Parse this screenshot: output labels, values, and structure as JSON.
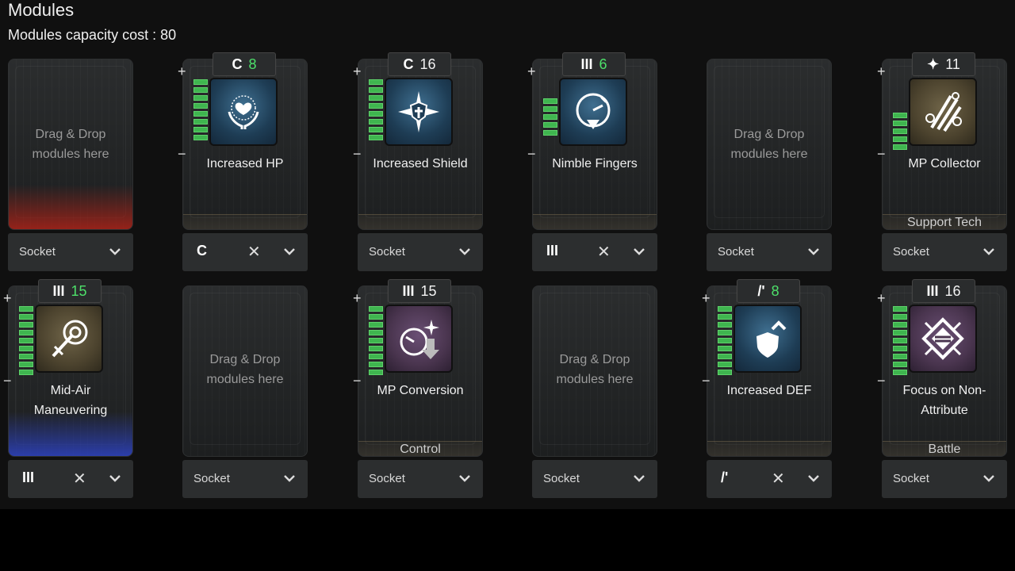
{
  "header": {
    "title": "Modules",
    "capacity": "Modules capacity cost : 80"
  },
  "labels": {
    "drag1": "Drag & Drop",
    "drag2": "modules here",
    "plus": "+",
    "minus": "−",
    "close": "✕",
    "socket": "Socket"
  },
  "slots": {
    "s1": {
      "state": "empty",
      "glow": "red"
    },
    "s2": {
      "cost": "8",
      "cost_green": true,
      "polarity": "crescent-icon",
      "glyph": "C",
      "name": "Increased HP",
      "filled_bars": 8
    },
    "s3": {
      "cost": "16",
      "cost_green": false,
      "polarity": "crescent-icon",
      "glyph": "C",
      "name": "Increased Shield",
      "filled_bars": 8
    },
    "s4": {
      "cost": "6",
      "cost_green": true,
      "polarity": "triple-bar-icon",
      "glyph": "III",
      "name": "Nimble Fingers",
      "filled_bars": 5
    },
    "s5": {
      "state": "empty"
    },
    "s6": {
      "cost": "11",
      "cost_green": false,
      "polarity": "star-icon",
      "glyph": "✦",
      "name": "MP Collector",
      "category": "Support Tech",
      "filled_bars": 5
    },
    "s7": {
      "cost": "15",
      "cost_green": true,
      "polarity": "triple-bar-icon",
      "glyph": "III",
      "name_l1": "Mid-Air",
      "name_l2": "Maneuvering",
      "filled_bars": 10
    },
    "s8": {
      "state": "empty"
    },
    "s9": {
      "cost": "15",
      "cost_green": false,
      "polarity": "triple-bar-icon",
      "glyph": "III",
      "name": "MP Conversion",
      "category": "Control",
      "filled_bars": 10
    },
    "s10": {
      "state": "empty"
    },
    "s11": {
      "cost": "8",
      "cost_green": true,
      "polarity": "slash-icon",
      "glyph": "/'",
      "name": "Increased DEF",
      "filled_bars": 10
    },
    "s12": {
      "cost": "16",
      "cost_green": false,
      "polarity": "triple-bar-icon",
      "glyph": "III",
      "name_l1": "Focus on Non-",
      "name_l2": "Attribute",
      "category": "Battle",
      "filled_bars": 8
    }
  },
  "colors": {
    "green": "#4de06a",
    "bar_green": "#3fb54f",
    "red_glow": "#aa2319",
    "blue_glow": "#2d41b9"
  }
}
